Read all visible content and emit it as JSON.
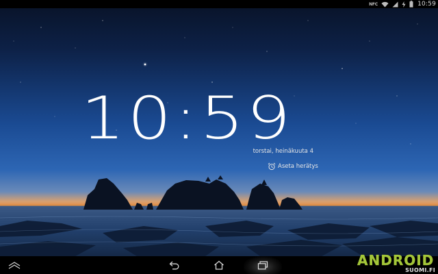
{
  "status_bar": {
    "time": "10:59",
    "nfc_label": "NFC",
    "icons": [
      "nfc-icon",
      "wifi-icon",
      "cellular-signal-icon",
      "charging-icon",
      "battery-icon"
    ]
  },
  "lockscreen": {
    "clock": "10:59",
    "date": "torstai, heinäkuuta 4",
    "alarm_label": "Aseta herätys",
    "alarm_icon": "alarm-clock-icon"
  },
  "nav_bar": {
    "buttons": [
      "up-arrow-icon",
      "back-icon",
      "home-icon",
      "recent-apps-icon"
    ]
  },
  "watermark": {
    "logo_text": "ANDROID",
    "subtitle": "SUOMI.FI",
    "logo_color": "#a4c639"
  },
  "colors": {
    "sky_top": "#0a1530",
    "sky_mid": "#1e4f9a",
    "horizon": "#e08a3c",
    "accent": "#a4c639"
  }
}
